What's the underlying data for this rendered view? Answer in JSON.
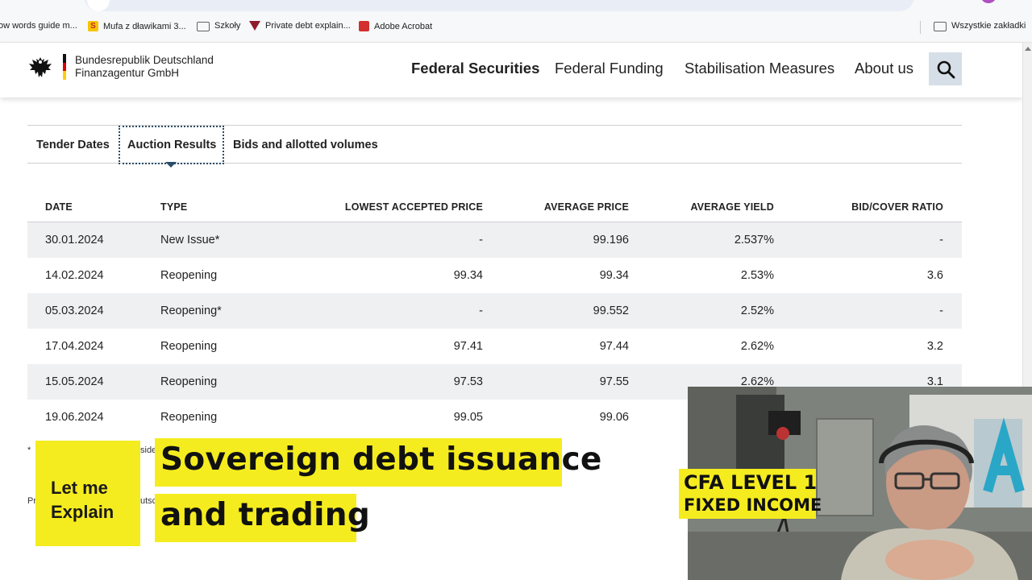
{
  "bookmarks": [
    {
      "label": "ow words guide m...",
      "icon": "none"
    },
    {
      "label": "Mufa z dławikami 3...",
      "icon": "s-favicon-icon"
    },
    {
      "label": "Szkoły",
      "icon": "folder-icon"
    },
    {
      "label": "Private debt explain...",
      "icon": "triangle-favicon-icon"
    },
    {
      "label": "Adobe Acrobat",
      "icon": "pdf-icon"
    },
    {
      "label": "Wszystkie zakładki",
      "icon": "folder-icon"
    }
  ],
  "site": {
    "logo_line1": "Bundesrepublik Deutschland",
    "logo_line2": "Finanzagentur GmbH",
    "nav": [
      "Federal Securities",
      "Federal Funding",
      "Stabilisation Measures",
      "About us"
    ],
    "active_nav": "Federal Securities"
  },
  "tabs": [
    "Tender Dates",
    "Auction Results",
    "Bids and allotted volumes"
  ],
  "active_tab": "Auction Results",
  "table": {
    "headers": [
      "DATE",
      "TYPE",
      "LOWEST ACCEPTED PRICE",
      "AVERAGE PRICE",
      "AVERAGE YIELD",
      "BID/COVER RATIO"
    ],
    "rows": [
      [
        "30.01.2024",
        "New Issue*",
        "-",
        "99.196",
        "2.537%",
        "-"
      ],
      [
        "14.02.2024",
        "Reopening",
        "99.34",
        "99.34",
        "2.53%",
        "3.6"
      ],
      [
        "05.03.2024",
        "Reopening*",
        "-",
        "99.552",
        "2.52%",
        "-"
      ],
      [
        "17.04.2024",
        "Reopening",
        "97.41",
        "97.44",
        "2.62%",
        "3.2"
      ],
      [
        "15.05.2024",
        "Reopening",
        "97.53",
        "97.55",
        "2.62%",
        "3.1"
      ],
      [
        "19.06.2024",
        "Reopening",
        "99.05",
        "99.06",
        "",
        ""
      ]
    ]
  },
  "footnotes": {
    "line1_start": "*",
    "line1_visible": "side",
    "line2_start": "Pr",
    "line2_visible": "utsc"
  },
  "overlay": {
    "badge_line1": "Let me",
    "badge_line2": "Explain",
    "title_line1": "Sovereign debt issuance",
    "title_line2": "and trading",
    "cfa_line1": "CFA LEVEL 1",
    "cfa_line2": "FIXED INCOME"
  },
  "colors": {
    "highlight_yellow": "#f5ec1f",
    "row_shade": "#eef0f2",
    "search_bg": "#d6dfe7",
    "focus_outline": "#2a4d69"
  }
}
